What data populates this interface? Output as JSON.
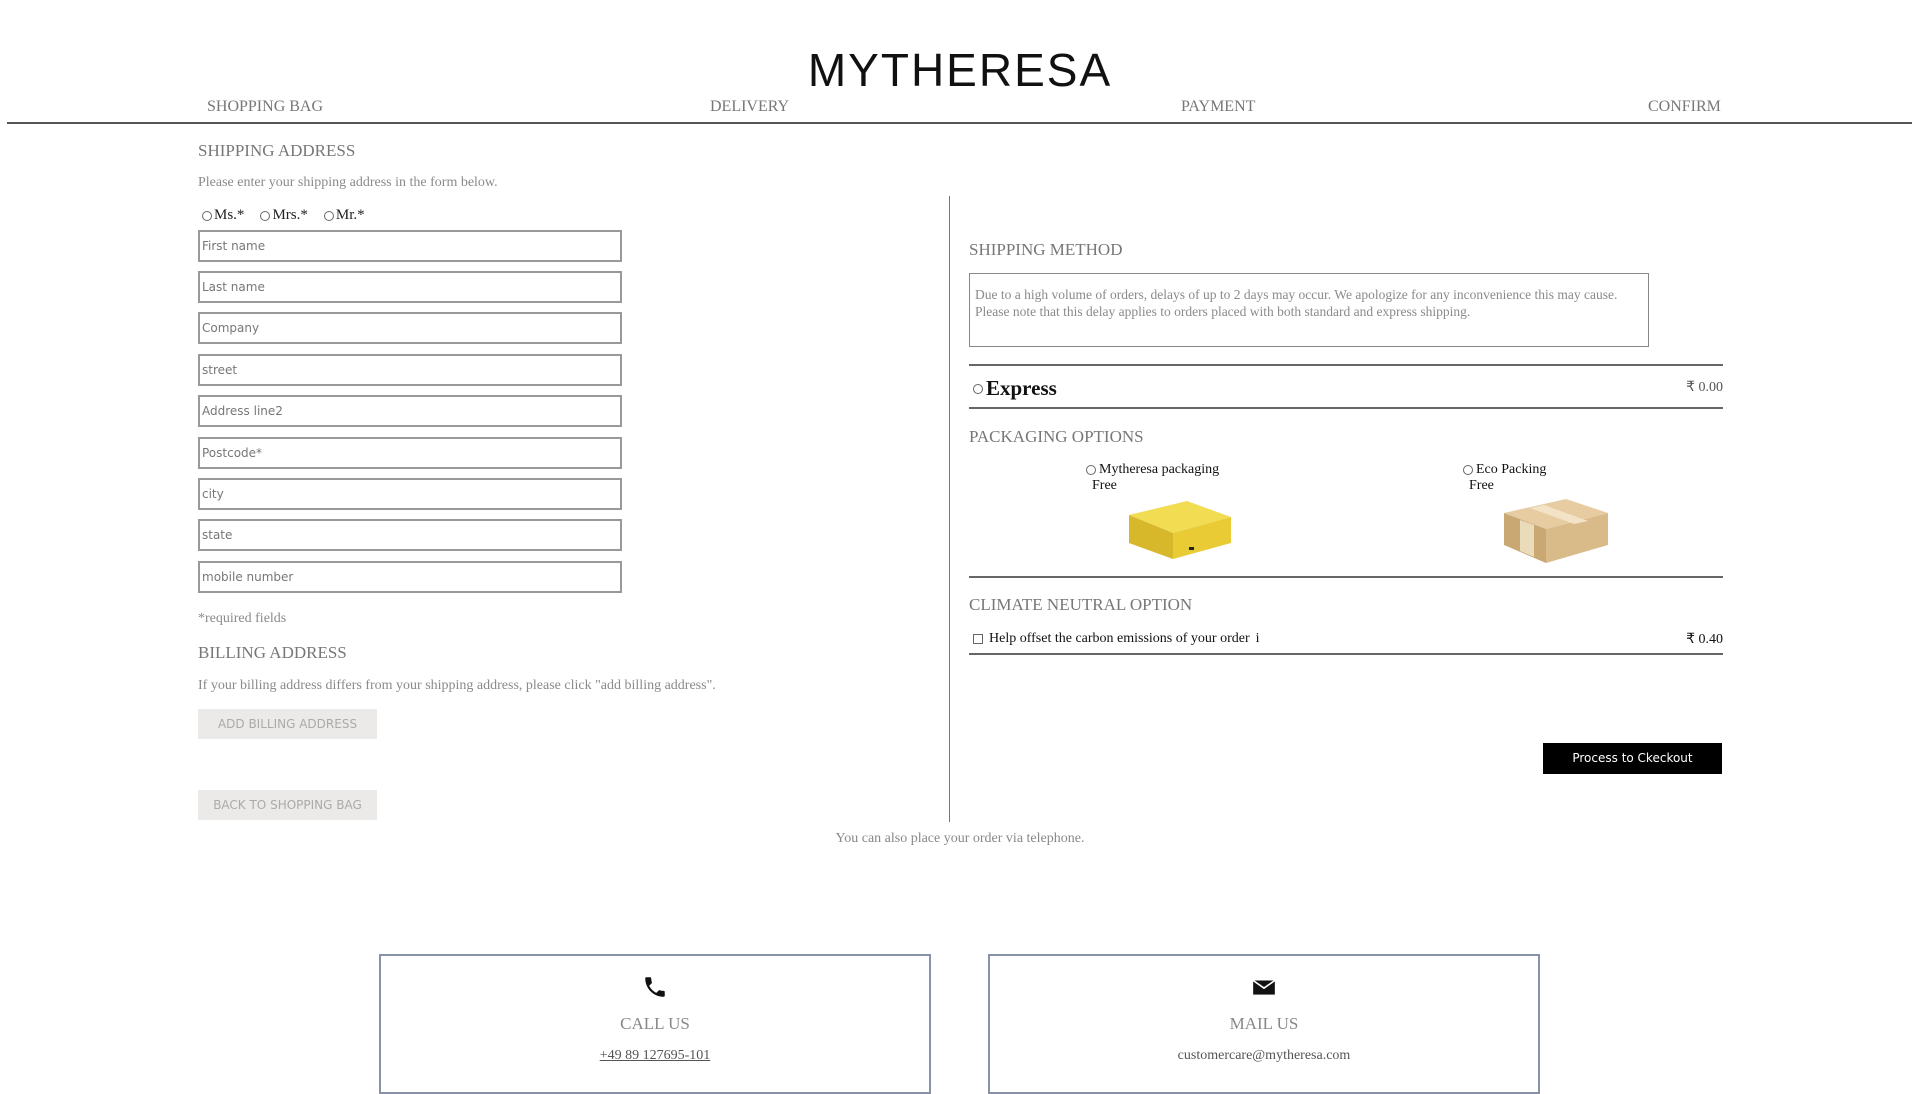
{
  "brand": {
    "logo_text": "MYTHERESA"
  },
  "steps": [
    "SHOPPING BAG",
    "DELIVERY",
    "PAYMENT",
    "CONFIRM"
  ],
  "shipping": {
    "title": "SHIPPING ADDRESS",
    "intro": "Please enter your shipping address in the form below.",
    "salutations": [
      "Ms.*",
      "Mrs.*",
      "Mr.*"
    ],
    "fields": {
      "first_name": "First name",
      "last_name": "Last name",
      "company": "Company",
      "street": "street",
      "address2": "Address line2",
      "postcode": "Postcode*",
      "city": "city",
      "state": "state",
      "mobile": "mobile number"
    },
    "required_note": "*required fields"
  },
  "billing": {
    "title": "BILLING ADDRESS",
    "intro": "If your billing address differs from your shipping address, please click \"add billing address\".",
    "add_button": "ADD BILLING ADDRESS",
    "back_button": "BACK TO SHOPPING BAG"
  },
  "shipping_method": {
    "title": "SHIPPING METHOD",
    "notice": "Due to a high volume of orders, delays of up to 2 days may occur. We apologize for any inconvenience this may cause. Please note that this delay applies to orders placed with both standard and express shipping.",
    "option_label": "Express",
    "option_price": "₹ 0.00"
  },
  "packaging": {
    "title": "PACKAGING OPTIONS",
    "options": [
      {
        "label": "Mytheresa packaging",
        "price": "Free"
      },
      {
        "label": "Eco Packing",
        "price": "Free"
      }
    ]
  },
  "climate": {
    "title": "CLIMATE NEUTRAL OPTION",
    "label": "Help offset the carbon emissions of your order",
    "info": "i",
    "price": "₹ 0.40"
  },
  "checkout_button": "Process to Ckeckout",
  "footer": {
    "telephone_note": "You can also place your order via telephone.",
    "call": {
      "title": "CALL US",
      "value": "+49 89 127695-101"
    },
    "mail": {
      "title": "MAIL US",
      "value": "customercare@mytheresa.com"
    }
  },
  "colors": {
    "accent_black": "#000000",
    "muted_button": "#eceae9",
    "box_yellow": "#e3c531",
    "box_cardboard": "#d6b98f"
  }
}
